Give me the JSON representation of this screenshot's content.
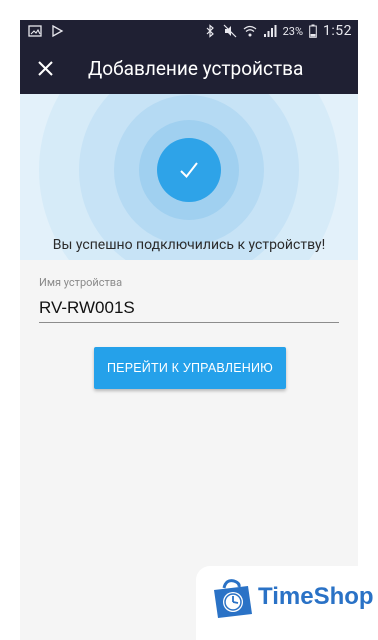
{
  "status_bar": {
    "battery_percent": "23%",
    "time": "1:52",
    "icons": [
      "image-icon",
      "play-icon",
      "bluetooth-icon",
      "mute-icon",
      "wifi-icon",
      "signal-icon",
      "battery-icon"
    ]
  },
  "app_bar": {
    "title": "Добавление устройства",
    "close_icon": "close-icon"
  },
  "success": {
    "message": "Вы успешно подключились к устройству!",
    "icon": "check-icon"
  },
  "form": {
    "device_name_label": "Имя устройства",
    "device_name_value": "RV-RW001S"
  },
  "actions": {
    "go_to_control_label": "ПЕРЕЙТИ К УПРАВЛЕНИЮ"
  },
  "watermark": {
    "brand": "TimeShop"
  },
  "colors": {
    "app_bar": "#1f2033",
    "accent": "#25a1ea",
    "background": "#f5f5f5"
  }
}
